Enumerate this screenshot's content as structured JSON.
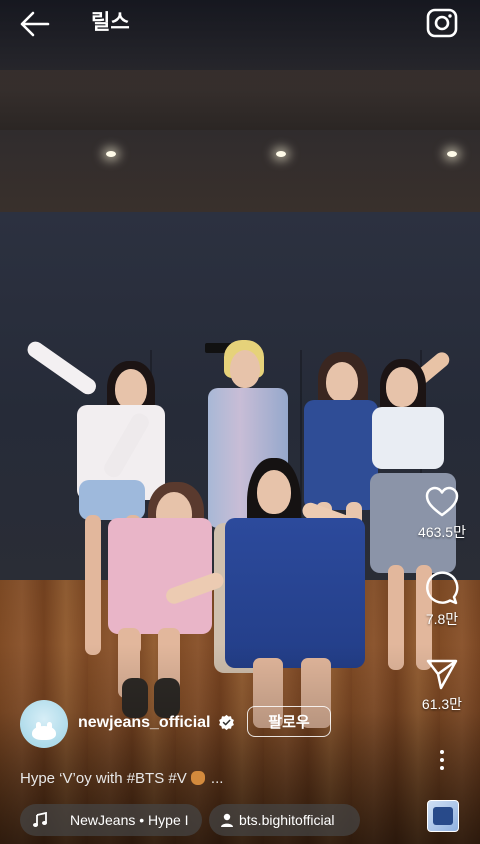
{
  "header": {
    "title": "릴스",
    "back_icon": "arrow-left-icon",
    "camera_icon": "camera-icon"
  },
  "actions": {
    "like": {
      "icon": "heart-icon",
      "count": "463.5만"
    },
    "comment": {
      "icon": "comment-icon",
      "count": "7.8만"
    },
    "share": {
      "icon": "send-icon",
      "count": "61.3만"
    },
    "more": {
      "icon": "more-vertical-icon"
    }
  },
  "post": {
    "username": "newjeans_official",
    "verified_icon": "verified-badge-icon",
    "follow_label": "팔로우",
    "caption": "Hype ‘V’oy with #BTS #V",
    "caption_suffix": "...",
    "caption_emoji": "bear-icon",
    "audio_label": "NewJeans • Hype I",
    "audio_icon": "music-note-icon",
    "tag_label": "bts.bighitofficial",
    "tag_icon": "person-icon"
  },
  "colors": {
    "text": "#ffffff",
    "chip_bg": "#464646"
  }
}
